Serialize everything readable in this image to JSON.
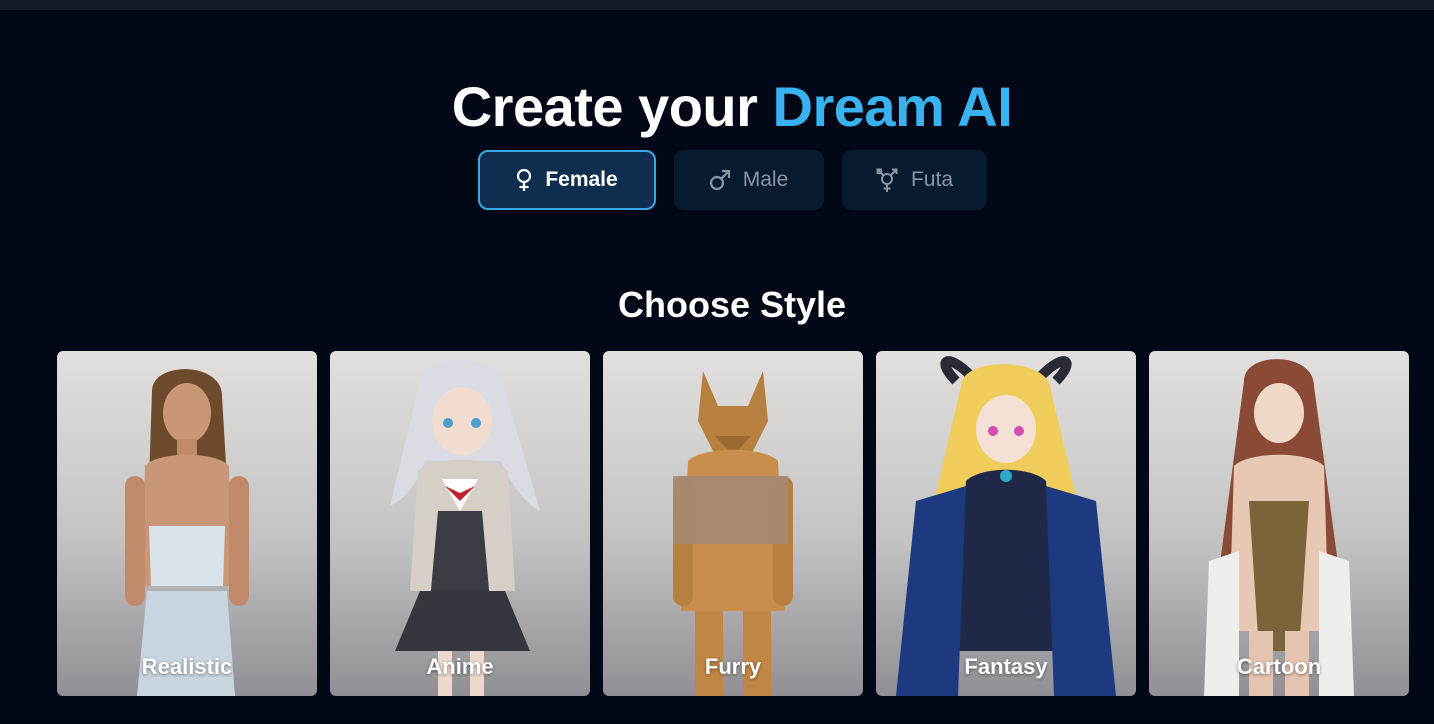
{
  "header": {
    "title_plain": "Create your",
    "title_accent": "Dream AI",
    "accent_color": "#39b2f0"
  },
  "gender_tabs": [
    {
      "label": "Female",
      "icon": "female-symbol-icon",
      "selected": true
    },
    {
      "label": "Male",
      "icon": "male-symbol-icon",
      "selected": false
    },
    {
      "label": "Futa",
      "icon": "transgender-symbol-icon",
      "selected": false
    }
  ],
  "style_section": {
    "title": "Choose Style",
    "cards": [
      {
        "label": "Realistic"
      },
      {
        "label": "Anime"
      },
      {
        "label": "Furry"
      },
      {
        "label": "Fantasy"
      },
      {
        "label": "Cartoon"
      }
    ]
  }
}
